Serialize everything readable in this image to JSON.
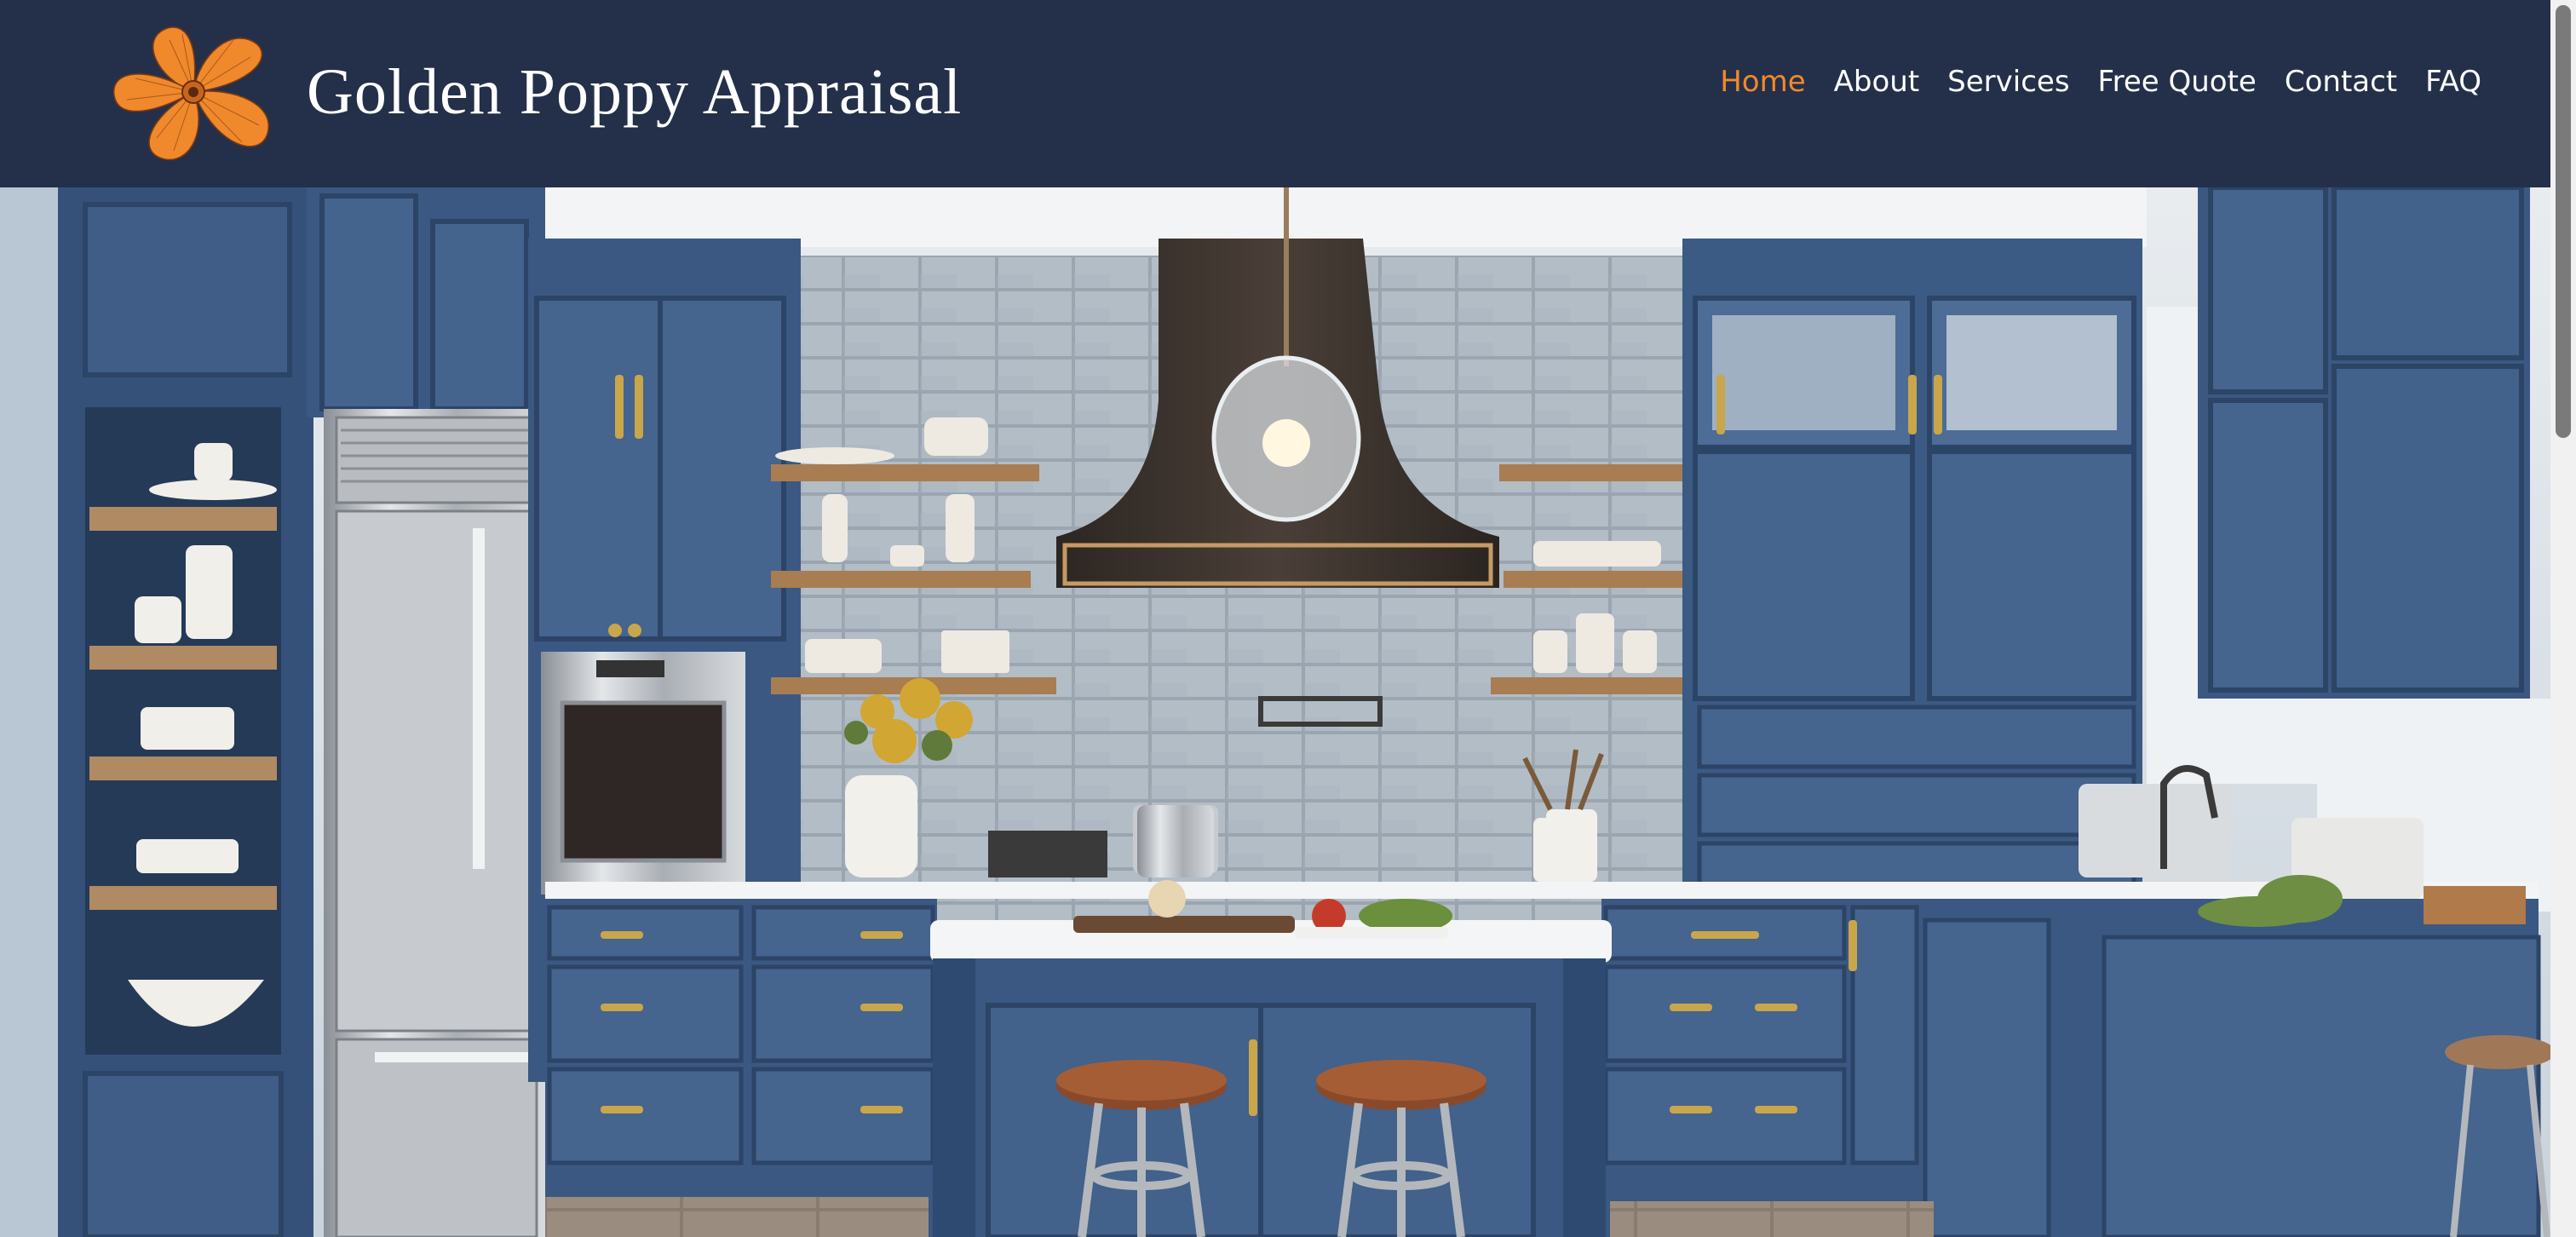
{
  "site": {
    "brand_name": "Golden Poppy Appraisal",
    "logo_icon": "poppy-flower-icon"
  },
  "nav": {
    "items": [
      {
        "label": "Home",
        "active": true
      },
      {
        "label": "About",
        "active": false
      },
      {
        "label": "Services",
        "active": false
      },
      {
        "label": "Free Quote",
        "active": false
      },
      {
        "label": "Contact",
        "active": false
      },
      {
        "label": "FAQ",
        "active": false
      }
    ]
  },
  "hero": {
    "image_subject": "blue-kitchen-photo"
  },
  "colors": {
    "header_bg": "#243049",
    "accent_orange": "#f0892c",
    "text_white": "#ffffff",
    "cabinet_blue": "#3d5a80"
  }
}
